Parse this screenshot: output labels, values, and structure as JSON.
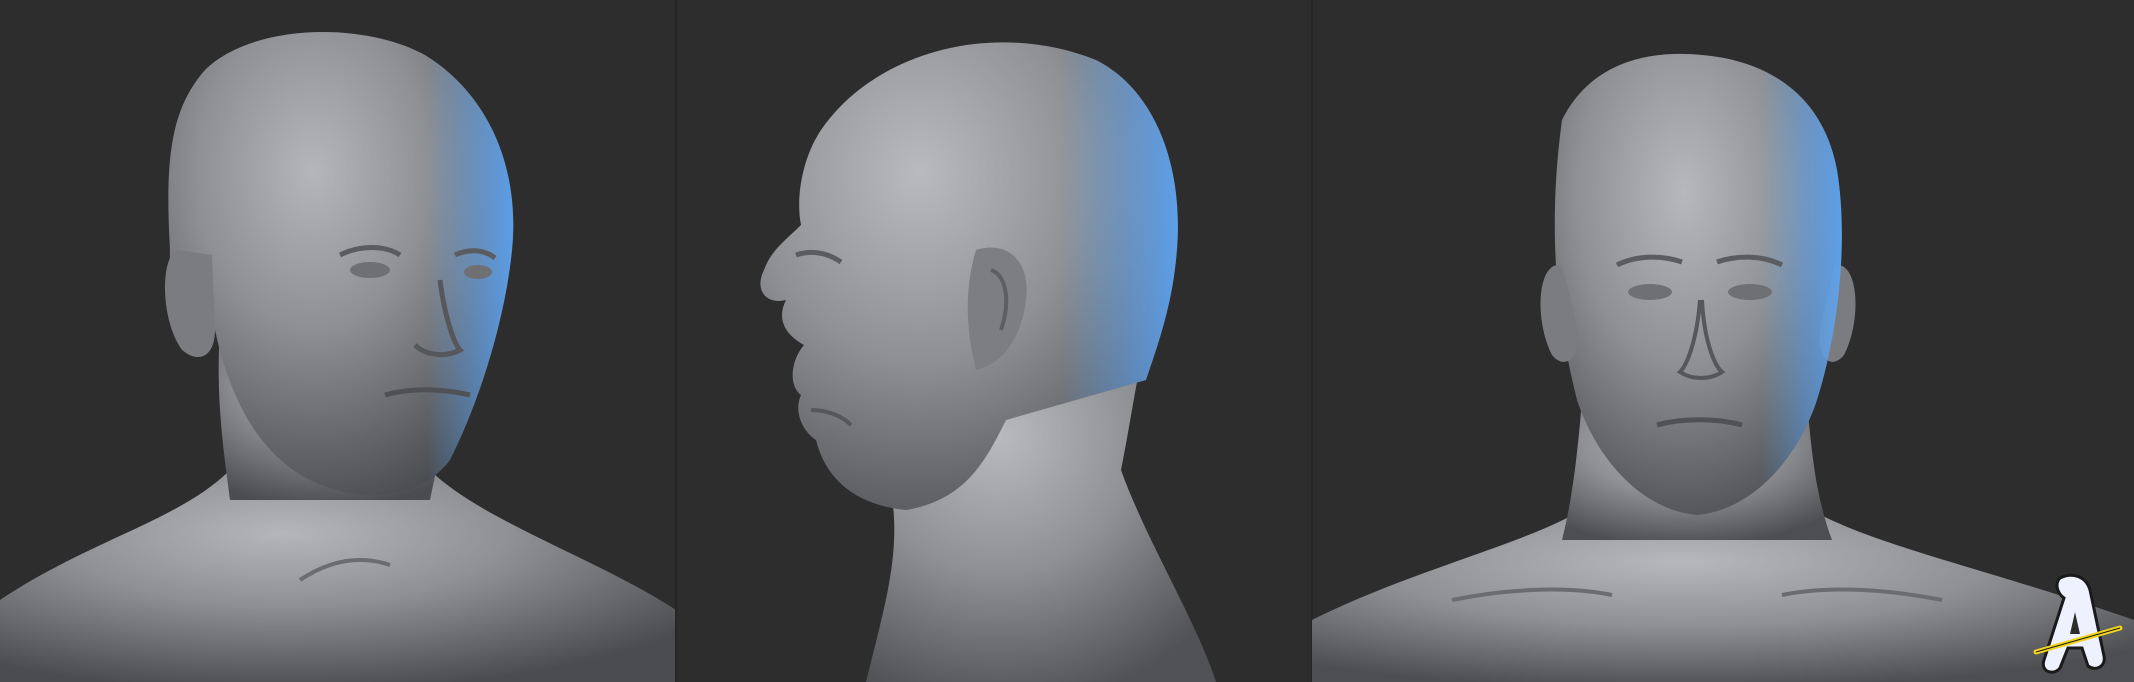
{
  "image": {
    "kind": "3d-sculpt-turnaround",
    "background": "#2d2d2e",
    "material": "#8d8f93",
    "rim_light": "#5aa8ff",
    "views": [
      {
        "id": "three-quarter",
        "label": ""
      },
      {
        "id": "profile-left",
        "label": ""
      },
      {
        "id": "front",
        "label": ""
      }
    ],
    "watermark": {
      "text": "A",
      "fill": "#eef2ff",
      "accent": "#f2d21a"
    }
  }
}
